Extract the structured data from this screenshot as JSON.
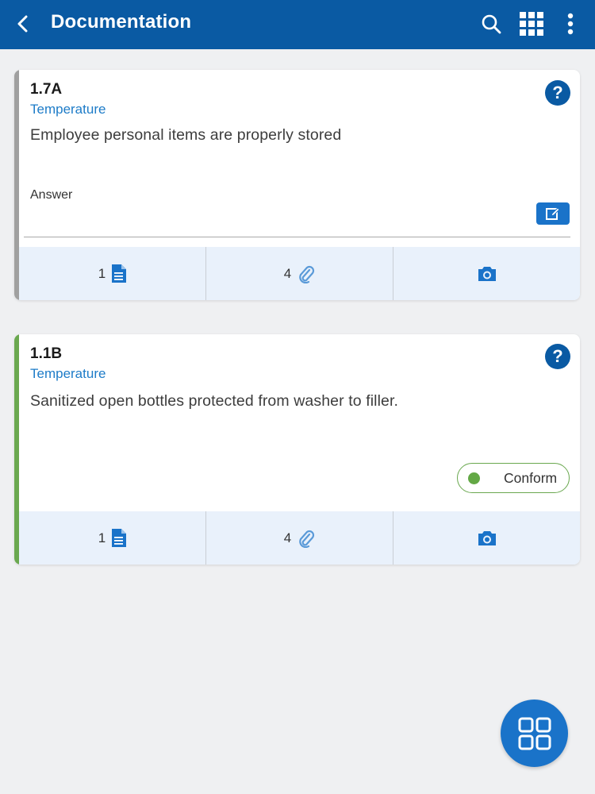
{
  "header": {
    "title": "Documentation",
    "back_icon": "chevron-left-icon",
    "actions": [
      "search-icon",
      "apps-grid-icon",
      "more-vert-icon"
    ],
    "color": "#0a5aa3"
  },
  "cards": [
    {
      "code": "1.7A",
      "category": "Temperature",
      "question": "Employee personal items are properly stored",
      "answer_label": "Answer",
      "status_color": "#a0a0a0",
      "footer": {
        "documents_count": "1",
        "attachments_count": "4"
      }
    },
    {
      "code": "1.1B",
      "category": "Temperature",
      "question": "Sanitized open bottles protected from washer to filler.",
      "answer": "Conform",
      "status_color": "#6aa84f",
      "footer": {
        "documents_count": "1",
        "attachments_count": "4"
      }
    }
  ],
  "fab": {
    "icon": "grid-view-icon"
  }
}
